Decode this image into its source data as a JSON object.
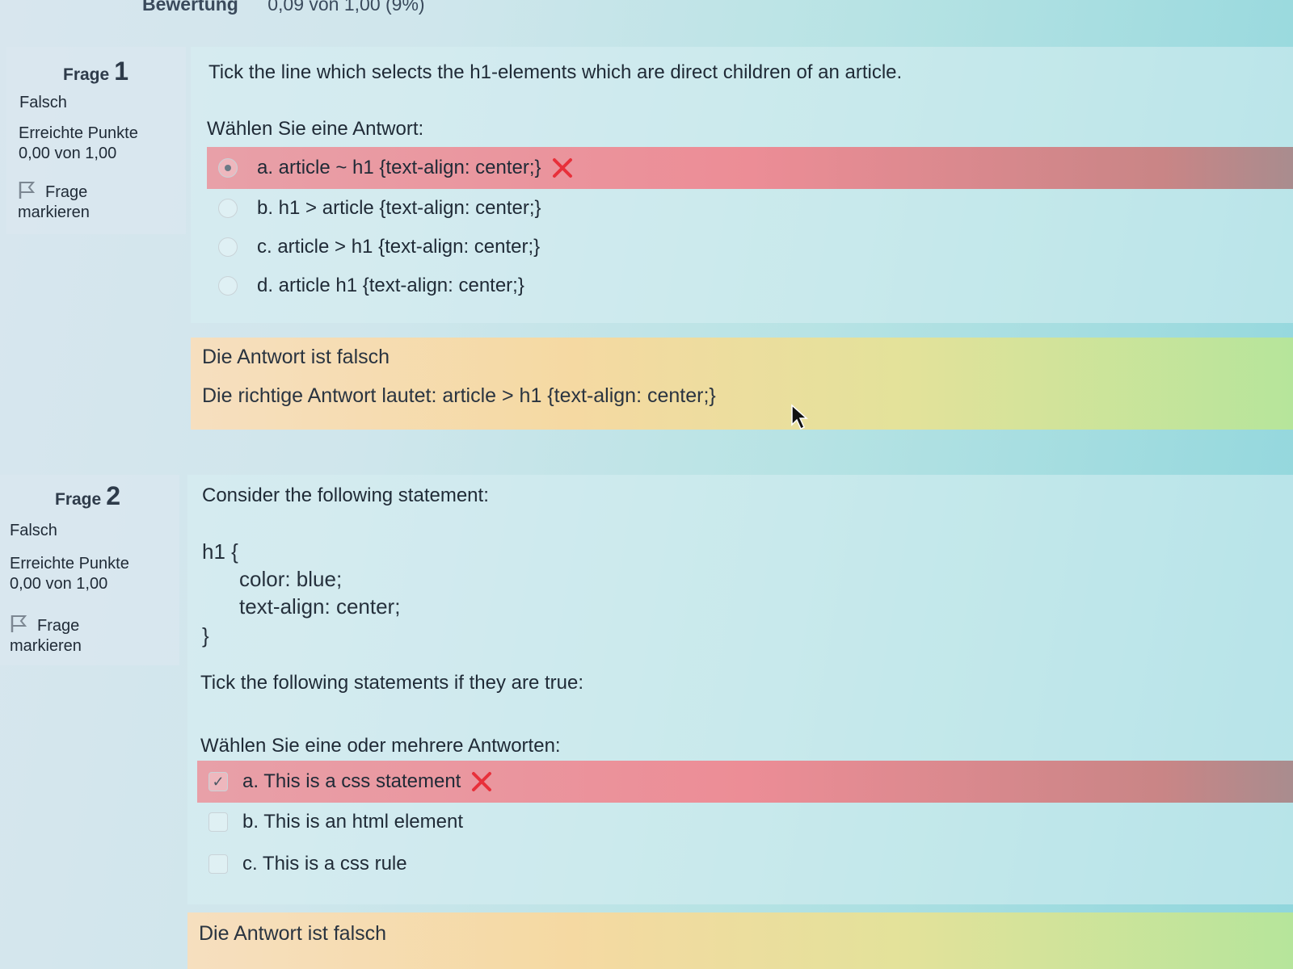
{
  "header": {
    "grade_label": "Bewertung",
    "grade_value": "0,09 von 1,00 (9%)"
  },
  "questions": [
    {
      "label": "Frage",
      "number": "1",
      "state": "Falsch",
      "grade_title": "Erreichte Punkte",
      "grade_value": "0,00 von 1,00",
      "flag_line1": "Frage",
      "flag_line2": "markieren",
      "text": "Tick the line which selects the h1-elements which are direct children of an article.",
      "prompt": "Wählen Sie eine Antwort:",
      "answers": [
        {
          "label": "a. article ~ h1 {text-align: center;}",
          "selected": true,
          "incorrect": true
        },
        {
          "label": "b. h1 > article {text-align: center;}",
          "selected": false,
          "incorrect": false
        },
        {
          "label": "c. article > h1 {text-align: center;}",
          "selected": false,
          "incorrect": false
        },
        {
          "label": "d. article h1 {text-align: center;}",
          "selected": false,
          "incorrect": false
        }
      ],
      "feedback_state": "Die Antwort ist falsch",
      "feedback_right": "Die richtige Antwort lautet: article > h1 {text-align: center;}"
    },
    {
      "label": "Frage",
      "number": "2",
      "state": "Falsch",
      "grade_title": "Erreichte Punkte",
      "grade_value": "0,00 von 1,00",
      "flag_line1": "Frage",
      "flag_line2": "markieren",
      "text": "Consider the following statement:",
      "code_lines": [
        "h1 {",
        "color: blue;",
        "text-align: center;",
        "}"
      ],
      "text2": "Tick the following statements if they are true:",
      "prompt": "Wählen Sie eine oder mehrere Antworten:",
      "answers": [
        {
          "label": "a. This is a css statement",
          "selected": true,
          "incorrect": true
        },
        {
          "label": "b. This is an html element",
          "selected": false,
          "incorrect": false
        },
        {
          "label": "c. This is a css rule",
          "selected": false,
          "incorrect": false
        }
      ],
      "feedback_state": "Die Antwort ist falsch"
    }
  ],
  "colors": {
    "incorrect_row": "#ec8d96",
    "wrong_mark": "#e8303a",
    "feedback": "#f5d9a2"
  },
  "icons": {
    "flag": "flag-icon",
    "wrong": "close-icon",
    "cursor": "mouse-pointer-icon"
  }
}
